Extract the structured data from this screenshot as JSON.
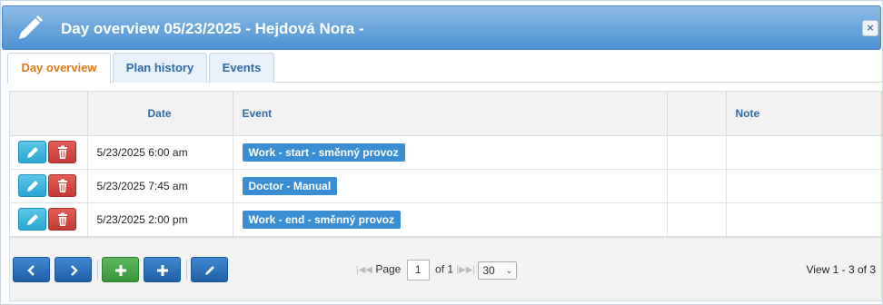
{
  "dialog": {
    "title": "Day overview 05/23/2025 - Hejdová Nora -",
    "close_label": "×"
  },
  "tabs": [
    {
      "label": "Day overview",
      "active": true
    },
    {
      "label": "Plan history",
      "active": false
    },
    {
      "label": "Events",
      "active": false
    }
  ],
  "grid": {
    "columns": [
      "",
      "Date",
      "Event",
      "",
      "Note"
    ],
    "rows": [
      {
        "date": "5/23/2025 6:00 am",
        "event": "Work - start - směnný provoz",
        "note": ""
      },
      {
        "date": "5/23/2025 7:45 am",
        "event": "Doctor - Manual",
        "note": ""
      },
      {
        "date": "5/23/2025 2:00 pm",
        "event": "Work - end - směnný provoz",
        "note": ""
      }
    ]
  },
  "pager": {
    "page_label": "Page",
    "page_value": "1",
    "of_label": "of 1",
    "page_size": "30",
    "view_text": "View 1 - 3 of 3"
  },
  "colors": {
    "accent": "#3b8ed2",
    "active_tab": "#e07b1a",
    "title_bar": "#6aa6dc"
  }
}
